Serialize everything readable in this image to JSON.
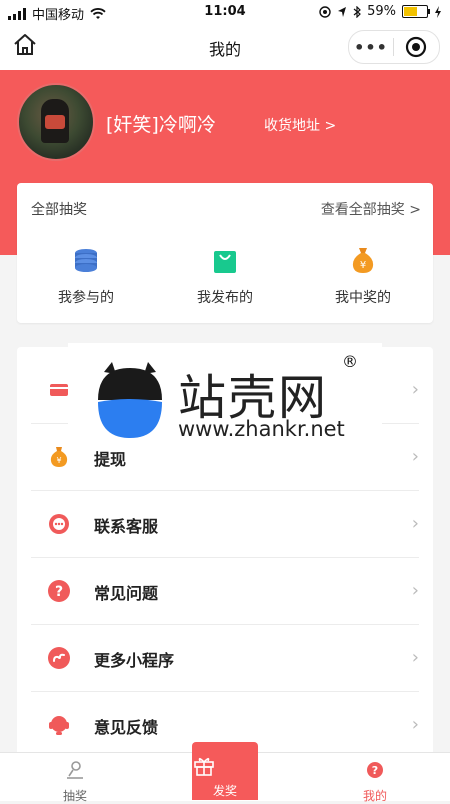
{
  "status_bar": {
    "carrier": "中国移动",
    "time": "11:04",
    "battery_percent": "59%",
    "battery_level": 0.59,
    "icons": [
      "signal-icon",
      "wifi-icon",
      "at-icon",
      "location-icon",
      "bluetooth-icon",
      "battery-icon",
      "charging-icon"
    ]
  },
  "navbar": {
    "title": "我的",
    "home_icon": "home-icon",
    "more_label": "•••",
    "close_icon": "target-icon"
  },
  "profile": {
    "username": "[奸笑]冷啊冷",
    "address_link": "收货地址 >"
  },
  "lottery_card": {
    "header_left": "全部抽奖",
    "header_right": "查看全部抽奖 >",
    "items": [
      {
        "label": "我参与的",
        "icon": "coins-stack-icon"
      },
      {
        "label": "我发布的",
        "icon": "shopping-bag-icon"
      },
      {
        "label": "我中奖的",
        "icon": "money-bag-icon"
      }
    ]
  },
  "menu": {
    "items": [
      {
        "label": "",
        "icon": "card-icon"
      },
      {
        "label": "提现",
        "icon": "money-bag-icon"
      },
      {
        "label": "联系客服",
        "icon": "chat-icon"
      },
      {
        "label": "常见问题",
        "icon": "question-icon"
      },
      {
        "label": "更多小程序",
        "icon": "mini-program-icon"
      },
      {
        "label": "意见反馈",
        "icon": "headset-icon"
      }
    ],
    "chevron": "›"
  },
  "watermark": {
    "title": "站壳网",
    "url": "www.zhankr.net",
    "registered": "®"
  },
  "tabbar": {
    "tabs": [
      {
        "label": "抽奖",
        "icon": "lottery-icon"
      },
      {
        "label": "发奖",
        "icon": "gift-icon"
      },
      {
        "label": "我的",
        "icon": "user-question-icon"
      }
    ]
  },
  "colors": {
    "brand_red": "#f55a5a",
    "text_dark": "#222222"
  }
}
